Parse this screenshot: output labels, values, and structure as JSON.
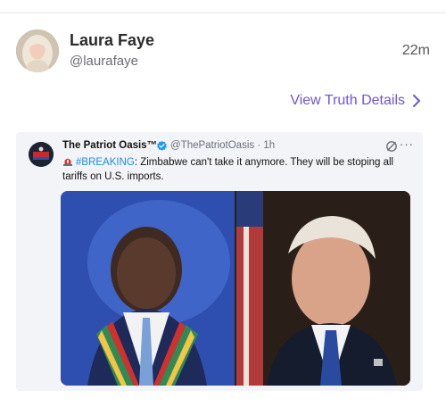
{
  "author": {
    "name": "Laura Faye",
    "handle": "@laurafaye",
    "time": "22m",
    "avatar_icon": "profile-photo"
  },
  "actions": {
    "view_details": "View Truth Details",
    "view_details_icon": "chevron-right-icon"
  },
  "embed": {
    "name": "The Patriot Oasis™",
    "handle": "@ThePatriotOasis · 1h",
    "verified_icon": "verified-badge-icon",
    "grok_icon": "slash-circle-icon",
    "more_icon": "ellipsis-icon",
    "text_hashtag": "#BREAKING",
    "text_body": ": Zimbabwe can't take it anymore. They will be stoping all tariffs on U.S. imports.",
    "siren_icon": "siren-emoji",
    "media": {
      "left_photo": "photo-left",
      "right_photo": "photo-right"
    }
  },
  "colors": {
    "accent": "#6e55d8",
    "hashtag": "#1d8ce0",
    "verified": "#1d9bf0"
  }
}
